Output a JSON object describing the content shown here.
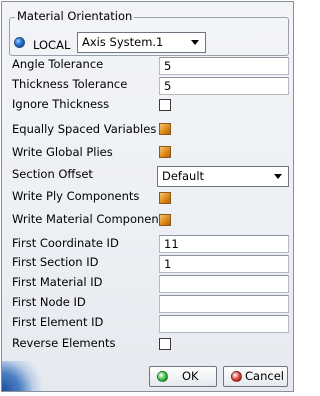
{
  "material_orientation": {
    "group_title": "Material Orientation",
    "radio_label": "LOCAL",
    "axis_system_value": "Axis System.1"
  },
  "fields": {
    "angle_tolerance": {
      "label": "Angle Tolerance",
      "value": "5"
    },
    "thickness_tolerance": {
      "label": "Thickness Tolerance",
      "value": "5"
    },
    "ignore_thickness": {
      "label": "Ignore Thickness",
      "checked": false
    },
    "equally_spaced_variables": {
      "label": "Equally Spaced Variables",
      "checked": true
    },
    "write_global_plies": {
      "label": "Write Global Plies",
      "checked": true
    },
    "section_offset": {
      "label": "Section Offset",
      "value": "Default"
    },
    "write_ply_components": {
      "label": "Write Ply Components",
      "checked": true
    },
    "write_material_components": {
      "label": "Write Material Components",
      "checked": true
    },
    "first_coordinate_id": {
      "label": "First Coordinate ID",
      "value": "11"
    },
    "first_section_id": {
      "label": "First Section ID",
      "value": "1"
    },
    "first_material_id": {
      "label": "First Material ID",
      "value": ""
    },
    "first_node_id": {
      "label": "First Node ID",
      "value": ""
    },
    "first_element_id": {
      "label": "First Element ID",
      "value": ""
    },
    "reverse_elements": {
      "label": "Reverse Elements",
      "checked": false
    }
  },
  "buttons": {
    "ok_label": "OK",
    "cancel_label": "Cancel"
  },
  "colors": {
    "ok_led": "#2fbf3a",
    "cancel_led": "#d9342b",
    "check_on": "#e08a1c"
  }
}
